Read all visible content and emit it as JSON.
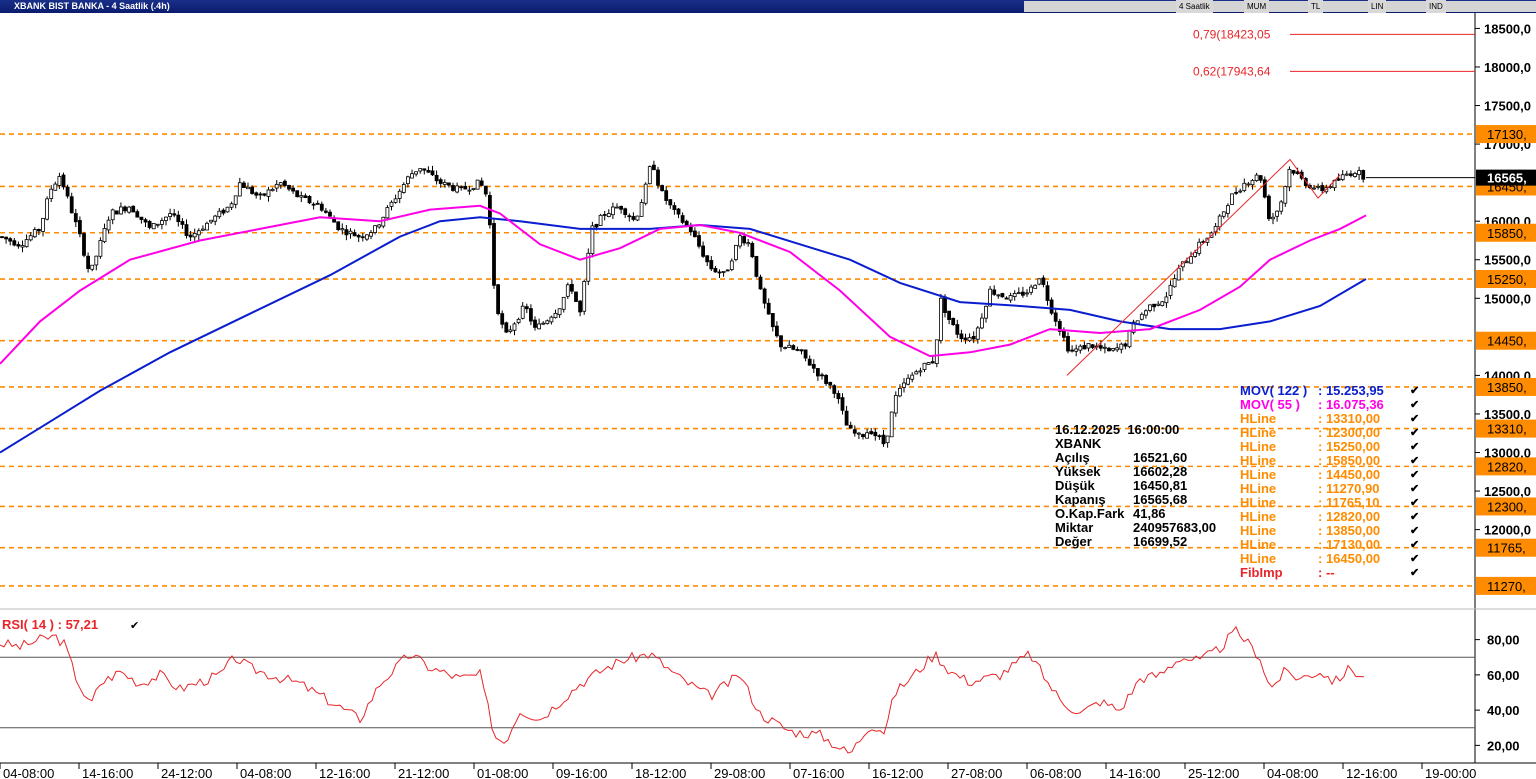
{
  "window": {
    "title": "XBANK BIST BANKA - 4 Saatlik (.4h)",
    "toolbar_options": [
      "4 Saatlik",
      "MUM",
      "TL",
      "LIN",
      "IND"
    ]
  },
  "colors": {
    "mov122": "#0a1ecf",
    "mov55": "#ff00e6",
    "hline": "#ff8c00",
    "fib": "#e8262a",
    "rsi": "#e8262a",
    "candle_up": "#ffffff",
    "candle_down": "#000000"
  },
  "chart_data": [
    {
      "type": "candlestick",
      "ylim": [
        11100,
        18700
      ],
      "y_ticks": [
        {
          "v": 18500,
          "label": "18500,0"
        },
        {
          "v": 18000,
          "label": "18000,0"
        },
        {
          "v": 17500,
          "label": "17500,0"
        },
        {
          "v": 17000,
          "label": "17000,0"
        },
        {
          "v": 16000,
          "label": "16000,0"
        },
        {
          "v": 15500,
          "label": "15500,0"
        },
        {
          "v": 15000,
          "label": "15000,0"
        },
        {
          "v": 14000,
          "label": "14000,0"
        },
        {
          "v": 13500,
          "label": "13500,0"
        },
        {
          "v": 13000,
          "label": "13000,0"
        },
        {
          "v": 12500,
          "label": "12500,0"
        },
        {
          "v": 12000,
          "label": "12000,0"
        }
      ],
      "x_labels": [
        "04-08:00",
        "14-16:00",
        "24-12:00",
        "04-08:00",
        "12-16:00",
        "21-12:00",
        "01-08:00",
        "09-16:00",
        "18-12:00",
        "29-08:00",
        "07-16:00",
        "16-12:00",
        "27-08:00",
        "06-08:00",
        "14-16:00",
        "25-12:00",
        "04-08:00",
        "12-16:00",
        "19-00:00"
      ],
      "price_path": [
        [
          0,
          15800
        ],
        [
          20,
          15700
        ],
        [
          40,
          15900
        ],
        [
          50,
          16400
        ],
        [
          60,
          16600
        ],
        [
          70,
          16200
        ],
        [
          80,
          15800
        ],
        [
          90,
          15300
        ],
        [
          100,
          15700
        ],
        [
          110,
          16100
        ],
        [
          130,
          16200
        ],
        [
          150,
          15900
        ],
        [
          170,
          16100
        ],
        [
          190,
          15800
        ],
        [
          210,
          16000
        ],
        [
          230,
          16200
        ],
        [
          240,
          16500
        ],
        [
          260,
          16300
        ],
        [
          280,
          16500
        ],
        [
          300,
          16300
        ],
        [
          320,
          16200
        ],
        [
          340,
          15900
        ],
        [
          360,
          15800
        ],
        [
          375,
          15900
        ],
        [
          390,
          16200
        ],
        [
          410,
          16600
        ],
        [
          420,
          16700
        ],
        [
          440,
          16500
        ],
        [
          460,
          16400
        ],
        [
          480,
          16500
        ],
        [
          488,
          16300
        ],
        [
          495,
          15000
        ],
        [
          505,
          14500
        ],
        [
          515,
          14700
        ],
        [
          525,
          14900
        ],
        [
          535,
          14600
        ],
        [
          545,
          14700
        ],
        [
          560,
          14900
        ],
        [
          570,
          15200
        ],
        [
          580,
          14800
        ],
        [
          592,
          15900
        ],
        [
          605,
          16100
        ],
        [
          620,
          16200
        ],
        [
          635,
          16000
        ],
        [
          645,
          16400
        ],
        [
          652,
          16800
        ],
        [
          660,
          16400
        ],
        [
          675,
          16100
        ],
        [
          690,
          15900
        ],
        [
          710,
          15400
        ],
        [
          725,
          15300
        ],
        [
          740,
          15800
        ],
        [
          750,
          15700
        ],
        [
          760,
          15100
        ],
        [
          770,
          14700
        ],
        [
          780,
          14400
        ],
        [
          800,
          14300
        ],
        [
          820,
          14000
        ],
        [
          835,
          13800
        ],
        [
          848,
          13300
        ],
        [
          860,
          13200
        ],
        [
          870,
          13300
        ],
        [
          885,
          13100
        ],
        [
          895,
          13700
        ],
        [
          905,
          13900
        ],
        [
          920,
          14100
        ],
        [
          935,
          14200
        ],
        [
          940,
          15000
        ],
        [
          950,
          14700
        ],
        [
          960,
          14500
        ],
        [
          975,
          14500
        ],
        [
          990,
          15100
        ],
        [
          1010,
          15000
        ],
        [
          1030,
          15100
        ],
        [
          1040,
          15300
        ],
        [
          1050,
          14900
        ],
        [
          1060,
          14600
        ],
        [
          1070,
          14300
        ],
        [
          1090,
          14400
        ],
        [
          1110,
          14300
        ],
        [
          1125,
          14400
        ],
        [
          1135,
          14700
        ],
        [
          1150,
          14900
        ],
        [
          1165,
          15000
        ],
        [
          1180,
          15400
        ],
        [
          1200,
          15700
        ],
        [
          1215,
          15900
        ],
        [
          1230,
          16300
        ],
        [
          1245,
          16500
        ],
        [
          1260,
          16600
        ],
        [
          1270,
          16000
        ],
        [
          1280,
          16200
        ],
        [
          1290,
          16700
        ],
        [
          1305,
          16500
        ],
        [
          1320,
          16400
        ],
        [
          1335,
          16500
        ],
        [
          1345,
          16600
        ],
        [
          1355,
          16650
        ],
        [
          1366,
          16566
        ]
      ],
      "overlays": {
        "mov122": {
          "name": "MOV( 122 )",
          "value": "15.253,95",
          "path": [
            [
              0,
              13000
            ],
            [
              50,
              13400
            ],
            [
              100,
              13800
            ],
            [
              170,
              14300
            ],
            [
              250,
              14800
            ],
            [
              330,
              15300
            ],
            [
              400,
              15800
            ],
            [
              440,
              16000
            ],
            [
              480,
              16050
            ],
            [
              520,
              16000
            ],
            [
              580,
              15900
            ],
            [
              650,
              15900
            ],
            [
              700,
              15950
            ],
            [
              750,
              15900
            ],
            [
              800,
              15700
            ],
            [
              850,
              15500
            ],
            [
              900,
              15200
            ],
            [
              960,
              14950
            ],
            [
              1020,
              14900
            ],
            [
              1070,
              14850
            ],
            [
              1120,
              14700
            ],
            [
              1170,
              14600
            ],
            [
              1220,
              14600
            ],
            [
              1270,
              14700
            ],
            [
              1320,
              14900
            ],
            [
              1366,
              15250
            ]
          ]
        },
        "mov55": {
          "name": "MOV( 55 )",
          "value": "16.075,36",
          "path": [
            [
              0,
              14150
            ],
            [
              40,
              14700
            ],
            [
              80,
              15100
            ],
            [
              130,
              15500
            ],
            [
              200,
              15750
            ],
            [
              260,
              15900
            ],
            [
              320,
              16050
            ],
            [
              380,
              16000
            ],
            [
              430,
              16150
            ],
            [
              480,
              16200
            ],
            [
              500,
              16100
            ],
            [
              540,
              15700
            ],
            [
              580,
              15500
            ],
            [
              620,
              15650
            ],
            [
              660,
              15900
            ],
            [
              700,
              15950
            ],
            [
              740,
              15850
            ],
            [
              790,
              15600
            ],
            [
              840,
              15100
            ],
            [
              890,
              14500
            ],
            [
              930,
              14250
            ],
            [
              970,
              14300
            ],
            [
              1010,
              14400
            ],
            [
              1050,
              14600
            ],
            [
              1100,
              14550
            ],
            [
              1150,
              14600
            ],
            [
              1200,
              14850
            ],
            [
              1240,
              15150
            ],
            [
              1270,
              15500
            ],
            [
              1310,
              15750
            ],
            [
              1340,
              15900
            ],
            [
              1366,
              16075
            ]
          ]
        }
      },
      "hlines": [
        {
          "value": 17130,
          "label": "17130,"
        },
        {
          "value": 16450,
          "label": "16450,"
        },
        {
          "value": 15850,
          "label": "15850,"
        },
        {
          "value": 15250,
          "label": "15250,"
        },
        {
          "value": 14450,
          "label": "14450,"
        },
        {
          "value": 13850,
          "label": "13850,"
        },
        {
          "value": 13310,
          "label": "13310,"
        },
        {
          "value": 12820,
          "label": "12820,"
        },
        {
          "value": 12300,
          "label": "12300,"
        },
        {
          "value": 11765,
          "label": "11765,"
        },
        {
          "value": 11270,
          "label": "11270,"
        }
      ],
      "fib_levels": [
        {
          "value": 18423,
          "label": "0,79(18423,05"
        },
        {
          "value": 17943,
          "label": "0,62(17943,64"
        }
      ],
      "current_price": {
        "value": 16565,
        "label": "16565,"
      },
      "info_box": {
        "date": "16.12.2025",
        "time": "16:00:00",
        "symbol": "XBANK",
        "rows": [
          {
            "label": "Açılış",
            "value": "16521,60"
          },
          {
            "label": "Yüksek",
            "value": "16602,28"
          },
          {
            "label": "Düşük",
            "value": "16450,81"
          },
          {
            "label": "Kapanış",
            "value": "16565,68"
          },
          {
            "label": "O.Kap.Fark",
            "value": "41,86"
          },
          {
            "label": "Miktar",
            "value": "240957683,00"
          },
          {
            "label": "Değer",
            "value": "16699,52"
          }
        ]
      },
      "legend": [
        {
          "name": "MOV( 122 )",
          "value": ": 15.253,95",
          "color": "#0a1ecf"
        },
        {
          "name": "MOV( 55 )",
          "value": ": 16.075,36",
          "color": "#ff00e6"
        },
        {
          "name": "HLine",
          "value": ": 13310,00",
          "color": "#ff8c00"
        },
        {
          "name": "HLine",
          "value": ": 12300,00",
          "color": "#ff8c00"
        },
        {
          "name": "HLine",
          "value": ": 15250,00",
          "color": "#ff8c00"
        },
        {
          "name": "HLine",
          "value": ": 15850,00",
          "color": "#ff8c00"
        },
        {
          "name": "HLine",
          "value": ": 14450,00",
          "color": "#ff8c00"
        },
        {
          "name": "HLine",
          "value": ": 11270,90",
          "color": "#ff8c00"
        },
        {
          "name": "HLine",
          "value": ": 11765,10",
          "color": "#ff8c00"
        },
        {
          "name": "HLine",
          "value": ": 12820,00",
          "color": "#ff8c00"
        },
        {
          "name": "HLine",
          "value": ": 13850,00",
          "color": "#ff8c00"
        },
        {
          "name": "HLine",
          "value": ": 17130,00",
          "color": "#ff8c00"
        },
        {
          "name": "HLine",
          "value": ": 16450,00",
          "color": "#ff8c00"
        },
        {
          "name": "FibImp",
          "value": ": --",
          "color": "#e8262a"
        }
      ]
    },
    {
      "type": "line",
      "name": "RSI( 14 )",
      "value": ": 57,21",
      "ylim": [
        10,
        90
      ],
      "y_ticks": [
        {
          "v": 80,
          "label": "80,00"
        },
        {
          "v": 60,
          "label": "60,00"
        },
        {
          "v": 40,
          "label": "40,00"
        },
        {
          "v": 20,
          "label": "20,00"
        }
      ],
      "levels": [
        70,
        30
      ],
      "path": [
        [
          0,
          78
        ],
        [
          20,
          76
        ],
        [
          40,
          80
        ],
        [
          55,
          82
        ],
        [
          65,
          77
        ],
        [
          75,
          60
        ],
        [
          90,
          42
        ],
        [
          100,
          55
        ],
        [
          120,
          62
        ],
        [
          140,
          55
        ],
        [
          160,
          60
        ],
        [
          180,
          52
        ],
        [
          200,
          56
        ],
        [
          220,
          60
        ],
        [
          235,
          70
        ],
        [
          250,
          64
        ],
        [
          270,
          60
        ],
        [
          300,
          55
        ],
        [
          330,
          45
        ],
        [
          360,
          35
        ],
        [
          380,
          55
        ],
        [
          410,
          72
        ],
        [
          430,
          64
        ],
        [
          460,
          58
        ],
        [
          480,
          60
        ],
        [
          495,
          25
        ],
        [
          505,
          22
        ],
        [
          520,
          40
        ],
        [
          540,
          35
        ],
        [
          560,
          45
        ],
        [
          580,
          55
        ],
        [
          600,
          62
        ],
        [
          620,
          68
        ],
        [
          650,
          72
        ],
        [
          680,
          58
        ],
        [
          710,
          48
        ],
        [
          740,
          60
        ],
        [
          760,
          38
        ],
        [
          790,
          28
        ],
        [
          820,
          26
        ],
        [
          850,
          15
        ],
        [
          870,
          32
        ],
        [
          885,
          28
        ],
        [
          895,
          50
        ],
        [
          910,
          58
        ],
        [
          935,
          72
        ],
        [
          950,
          62
        ],
        [
          970,
          56
        ],
        [
          1000,
          60
        ],
        [
          1030,
          72
        ],
        [
          1045,
          58
        ],
        [
          1060,
          46
        ],
        [
          1080,
          38
        ],
        [
          1100,
          45
        ],
        [
          1120,
          40
        ],
        [
          1140,
          58
        ],
        [
          1160,
          60
        ],
        [
          1180,
          70
        ],
        [
          1200,
          68
        ],
        [
          1220,
          75
        ],
        [
          1235,
          85
        ],
        [
          1245,
          80
        ],
        [
          1260,
          70
        ],
        [
          1270,
          52
        ],
        [
          1285,
          62
        ],
        [
          1300,
          58
        ],
        [
          1320,
          62
        ],
        [
          1335,
          56
        ],
        [
          1350,
          64
        ],
        [
          1366,
          57
        ]
      ]
    }
  ]
}
